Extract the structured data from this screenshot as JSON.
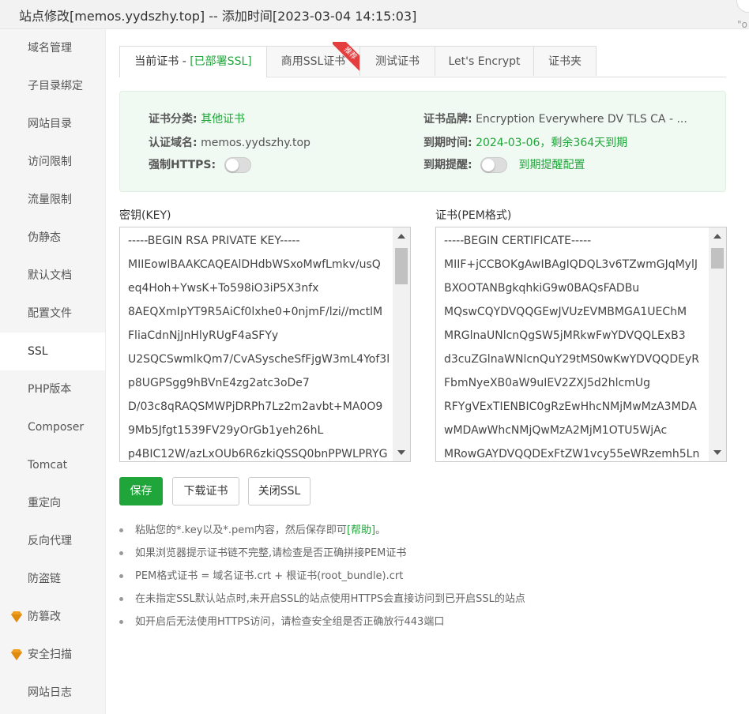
{
  "window": {
    "title": "站点修改[memos.yydszhy.top] -- 添加时间[2023-03-04 14:15:03]",
    "extra": "\"o"
  },
  "sidebar": {
    "items": [
      {
        "label": "域名管理"
      },
      {
        "label": "子目录绑定"
      },
      {
        "label": "网站目录"
      },
      {
        "label": "访问限制"
      },
      {
        "label": "流量限制"
      },
      {
        "label": "伪静态"
      },
      {
        "label": "默认文档"
      },
      {
        "label": "配置文件"
      },
      {
        "label": "SSL",
        "active": true
      },
      {
        "label": "PHP版本"
      },
      {
        "label": "Composer"
      },
      {
        "label": "Tomcat"
      },
      {
        "label": "重定向"
      },
      {
        "label": "反向代理"
      },
      {
        "label": "防盗链"
      },
      {
        "label": "防篡改",
        "icon": "gem-icon"
      },
      {
        "label": "安全扫描",
        "icon": "gem-icon"
      },
      {
        "label": "网站日志"
      }
    ]
  },
  "tabs": {
    "current_prefix": "当前证书 - ",
    "current_status": "[已部署SSL]",
    "commercial": "商用SSL证书",
    "commercial_badge": "推荐",
    "test": "测试证书",
    "letsencrypt": "Let's Encrypt",
    "folder": "证书夹"
  },
  "info": {
    "category_label": "证书分类:",
    "category_value": "其他证书",
    "brand_label": "证书品牌:",
    "brand_value": "Encryption Everywhere DV TLS CA - ...",
    "domain_label": "认证域名:",
    "domain_value": "memos.yydszhy.top",
    "expire_label": "到期时间:",
    "expire_value": "2024-03-06，剩余364天到期",
    "force_https_label": "强制HTTPS:",
    "reminder_label": "到期提醒:",
    "reminder_config": "到期提醒配置"
  },
  "key": {
    "label": "密钥(KEY)",
    "lines": [
      "-----BEGIN RSA PRIVATE KEY-----",
      "MIIEowIBAAKCAQEAlDHdbWSxoMwfLmkv/usQ",
      "eq4Hoh+YwsK+To598iO3iP5X3nfx",
      "8AEQXmIpYT9R5AiCf0lxhe0+0njmF/lzi//mctlM",
      "FliaCdnNjJnHlyRUgF4aSFYy",
      "U2SQCSwmlkQm7/CvASyscheSfFjgW3mL4Yof3l",
      "p8UGPSgg9hBVnE4zg2atc3oDe7",
      "D/03c8qRAQSMWPjDRPh7Lz2m2avbt+MA0O9",
      "9Mb5Jfgt1539FV29yOrGb1yeh26hL",
      "p4BIC12W/azLxOUb6R6zkiQSSQ0bnPPWLPRYG"
    ]
  },
  "cert": {
    "label": "证书(PEM格式)",
    "lines": [
      "-----BEGIN CERTIFICATE-----",
      "MIIF+jCCBOKgAwIBAgIQDQL3v6TZwmGJqMylJ",
      "BXOOTANBgkqhkiG9w0BAQsFADBu",
      "MQswCQYDVQQGEwJVUzEVMBMGA1UEChM",
      "MRGlnaUNlcnQgSW5jMRkwFwYDVQQLExB3",
      "d3cuZGlnaWNlcnQuY29tMS0wKwYDVQQDEyR",
      "FbmNyeXB0aW9uIEV2ZXJ5d2hlcmUg",
      "RFYgVExTIENBIC0gRzEwHhcNMjMwMzA3MDA",
      "wMDAwWhcNMjQwMzA2MjM1OTU5WjAc",
      "MRowGAYDVQQDExFtZW1vcy55eWRzemh5Ln"
    ]
  },
  "buttons": {
    "save": "保存",
    "download": "下载证书",
    "close_ssl": "关闭SSL"
  },
  "tips": {
    "tip1_prefix": "粘贴您的*.key以及*.pem内容，然后保存即可",
    "tip1_help": "[帮助]",
    "tip1_suffix": "。",
    "tip2": "如果浏览器提示证书链不完整,请检查是否正确拼接PEM证书",
    "tip3": "PEM格式证书 = 域名证书.crt + 根证书(root_bundle).crt",
    "tip4": "在未指定SSL默认站点时,未开启SSL的站点使用HTTPS会直接访问到已开启SSL的站点",
    "tip5": "如开启后无法使用HTTPS访问，请检查安全组是否正确放行443端口"
  },
  "colors": {
    "accent": "#20a53a",
    "badge": "#e53e3e",
    "gem": "#f0a020"
  }
}
